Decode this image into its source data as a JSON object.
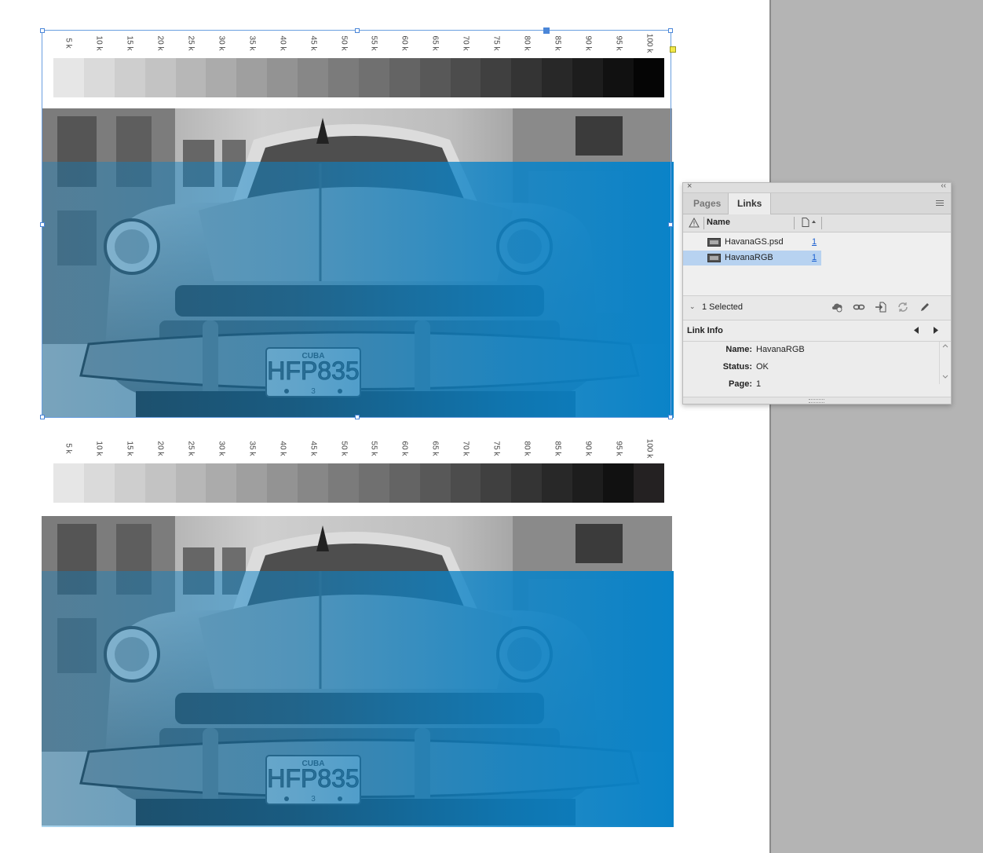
{
  "strip_labels": [
    "5 k",
    "10 k",
    "15 k",
    "20 k",
    "25 k",
    "30 k",
    "35 k",
    "40 k",
    "45 k",
    "50 k",
    "55 k",
    "60 k",
    "65 k",
    "70 k",
    "75 k",
    "80 k",
    "85 k",
    "90 k",
    "95 k",
    "100 k"
  ],
  "colors": {
    "overlay_blue": "#0a83c8",
    "selection_blue": "#4a86d8",
    "selected_row": "#b7d2f0",
    "link_blue": "#1a5fd0"
  },
  "photo": {
    "plate_country": "CUBA",
    "plate_number": "HFP835",
    "plate_sub": "3"
  },
  "panel": {
    "tabs": [
      {
        "label": "Pages",
        "active": false
      },
      {
        "label": "Links",
        "active": true
      }
    ],
    "column_name": "Name",
    "links": [
      {
        "name": "HavanaGS.psd",
        "page": "1",
        "selected": false
      },
      {
        "name": "HavanaRGB",
        "page": "1",
        "selected": true
      }
    ],
    "selected_count": "1 Selected",
    "toolbar_icons": [
      "cloud-icon",
      "relink-icon",
      "goto-link-icon",
      "update-link-icon",
      "edit-original-icon"
    ],
    "link_info_title": "Link Info",
    "info": [
      {
        "label": "Name:",
        "value": "HavanaRGB"
      },
      {
        "label": "Status:",
        "value": "OK"
      },
      {
        "label": "Page:",
        "value": "1"
      }
    ]
  }
}
